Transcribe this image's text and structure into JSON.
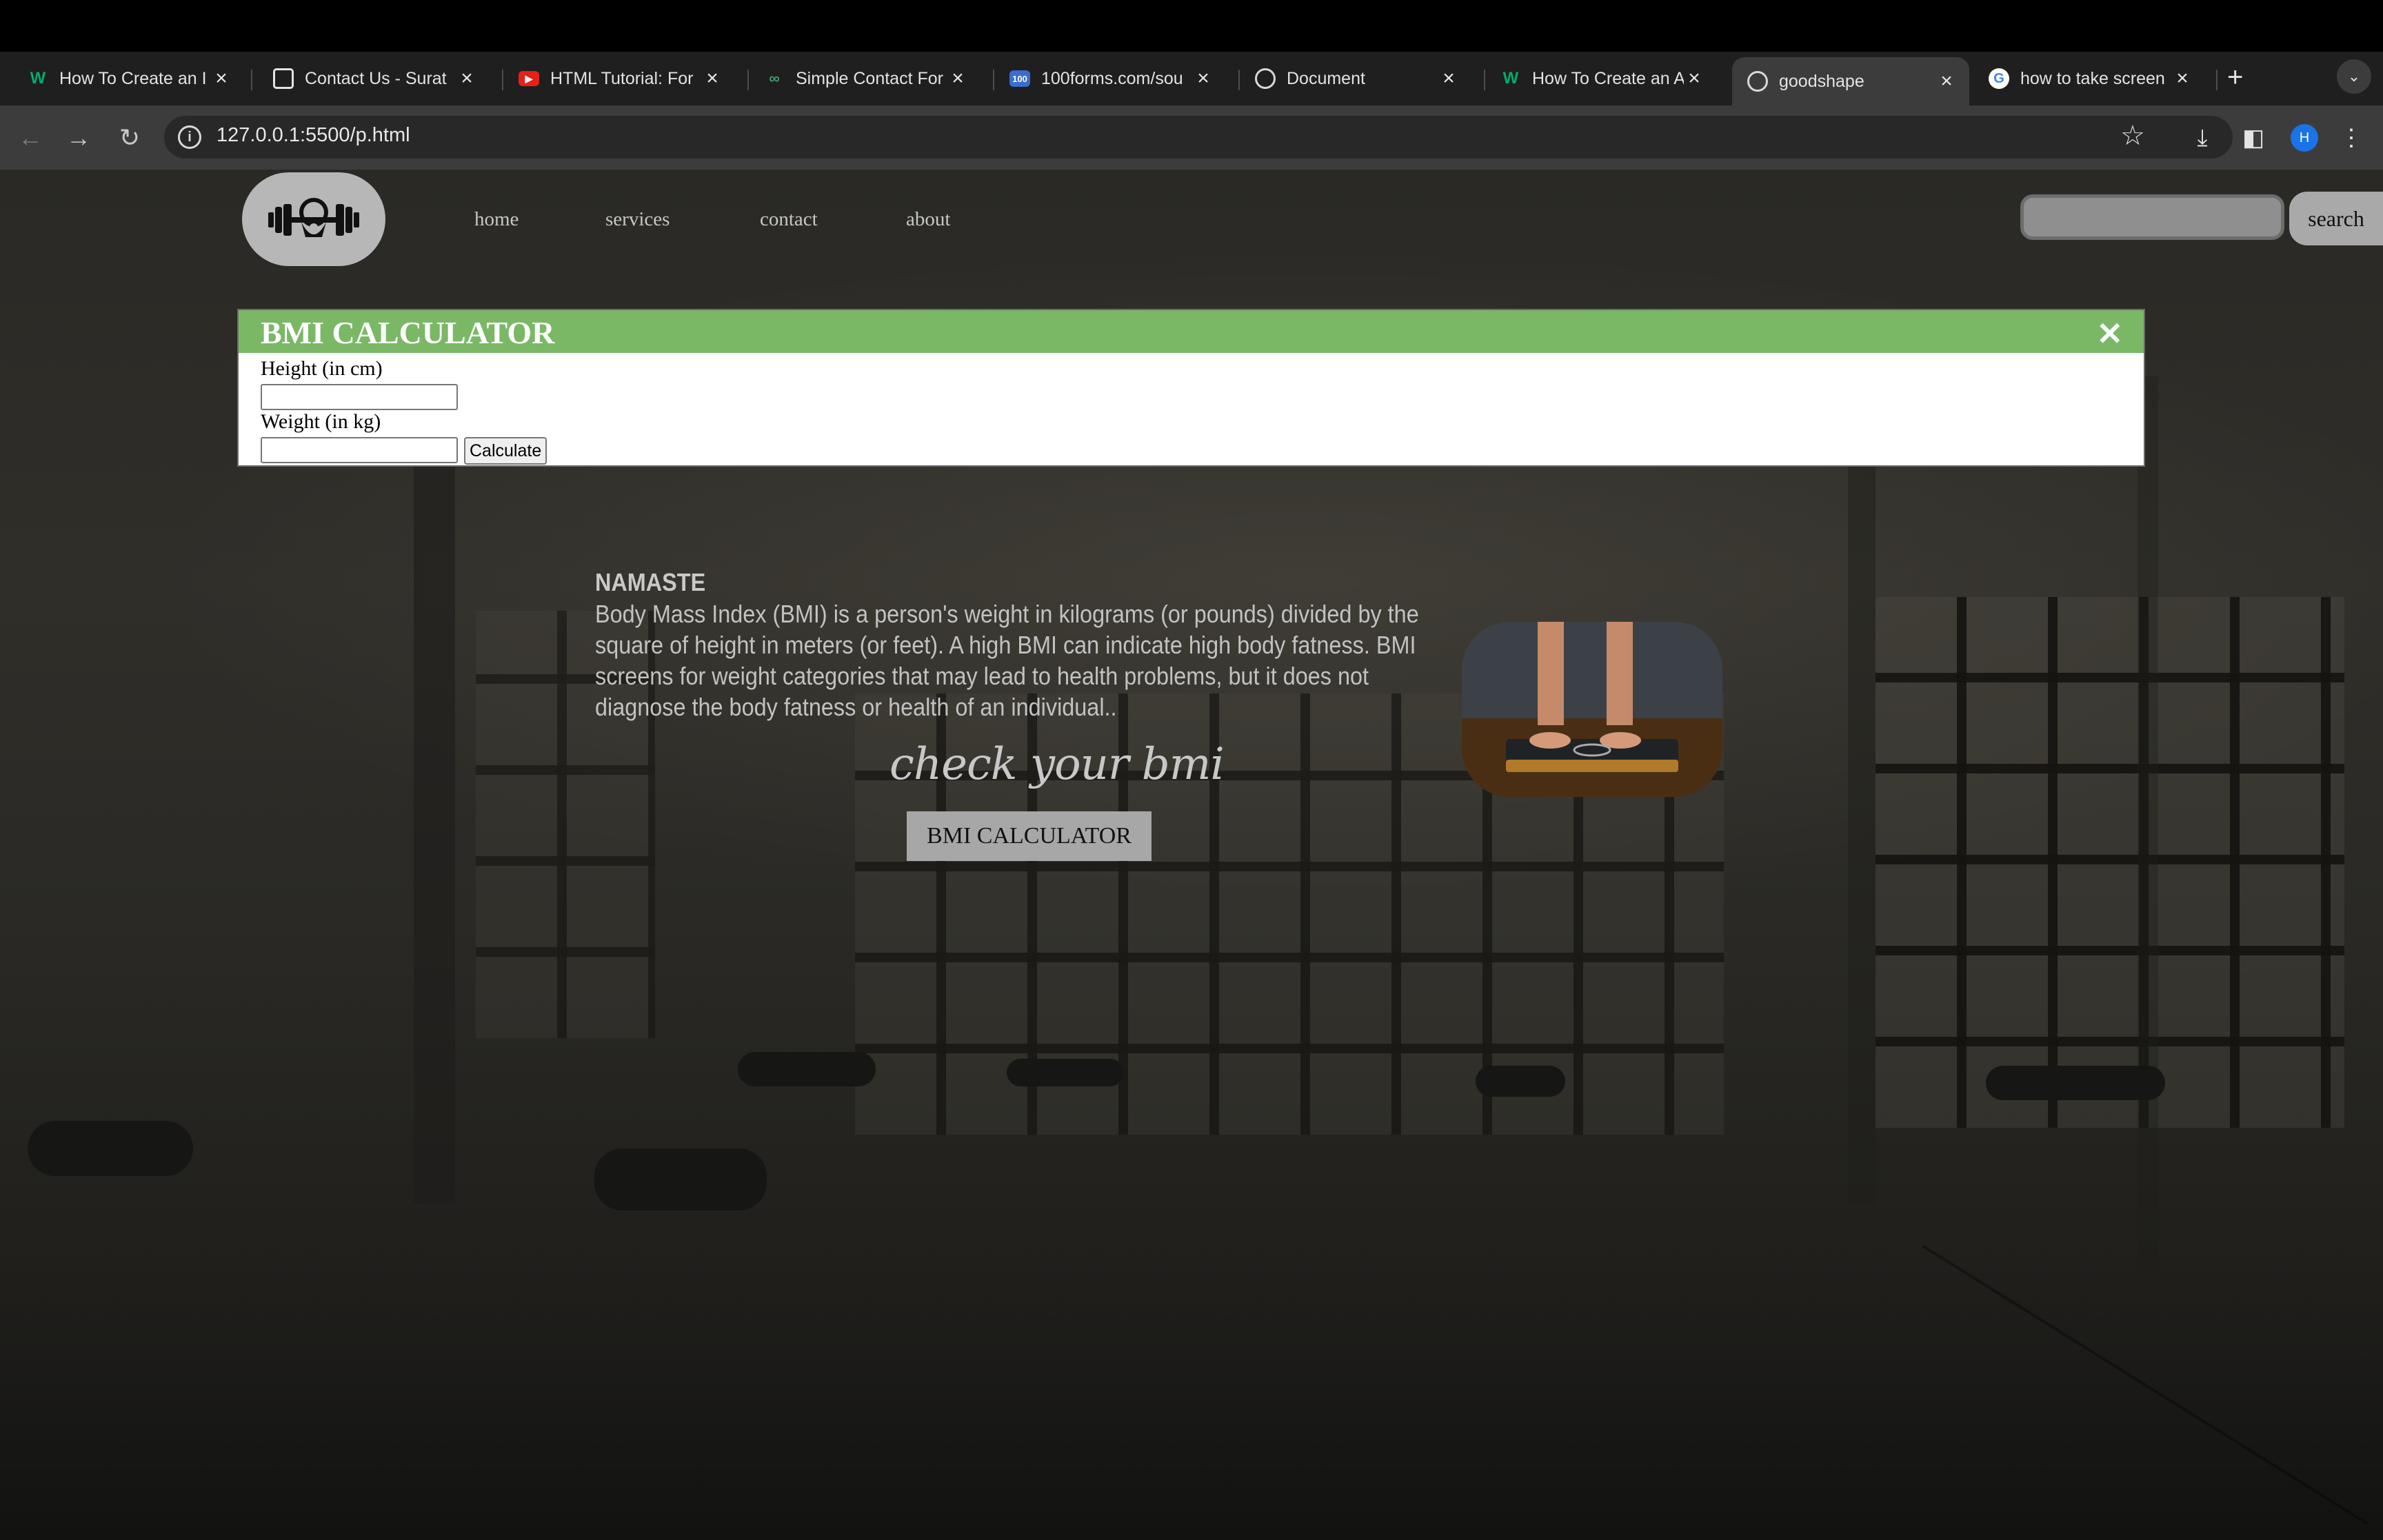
{
  "browser": {
    "tabs": [
      {
        "title": "How To Create an I",
        "favicon": "w3schools-icon",
        "active": false
      },
      {
        "title": "Contact Us - Surat",
        "favicon": "site-icon",
        "active": false
      },
      {
        "title": "HTML Tutorial: For",
        "favicon": "youtube-icon",
        "active": false
      },
      {
        "title": "Simple Contact For",
        "favicon": "codepen-icon",
        "active": false
      },
      {
        "title": "100forms.com/sou",
        "favicon": "100forms-icon",
        "active": false
      },
      {
        "title": "Document",
        "favicon": "globe-icon",
        "active": false
      },
      {
        "title": "How To Create an A",
        "favicon": "w3schools-icon",
        "active": false
      },
      {
        "title": "goodshape",
        "favicon": "globe-icon",
        "active": true
      },
      {
        "title": "how to take screen",
        "favicon": "google-icon",
        "active": false
      }
    ],
    "url": "127.0.0.1:5500/p.html",
    "profile_initial": "H"
  },
  "site": {
    "nav": [
      "home",
      "services",
      "contact",
      "about"
    ],
    "search_placeholder": "",
    "search_button": "search"
  },
  "bmi_popup": {
    "title": "BMI CALCULATOR",
    "close": "✕",
    "height_label": "Height (in cm)",
    "weight_label": "Weight (in kg)",
    "height_value": "",
    "weight_value": "",
    "calculate_button": "Calculate"
  },
  "content": {
    "heading": "NAMASTE",
    "description": "Body Mass Index (BMI) is a person's weight in kilograms (or pounds) divided by the square of height in meters (or feet). A high BMI can indicate high body fatness. BMI screens for weight categories that may lead to health problems, but it does not diagnose the body fatness or health of an individual..",
    "cta_text": "check your bmi",
    "cta_button": "BMI CALCULATOR"
  },
  "colors": {
    "popup_header": "#7ab866",
    "chrome_bg": "#1f1f1f",
    "toolbar_bg": "#3c3c3c"
  }
}
